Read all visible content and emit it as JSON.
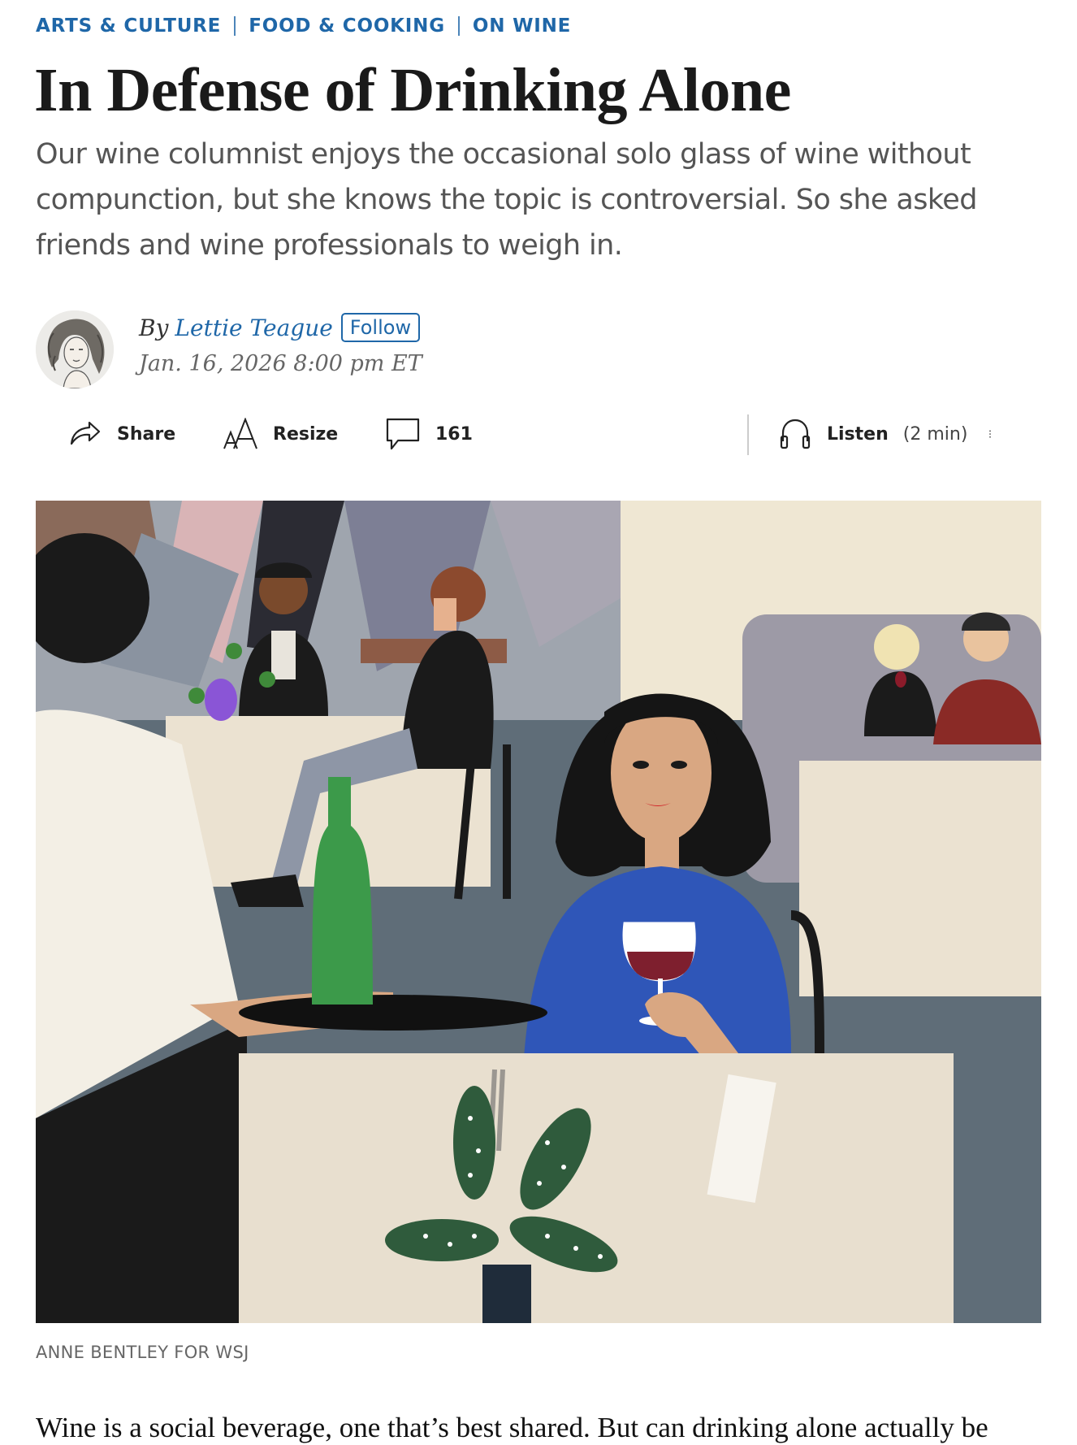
{
  "breadcrumb": {
    "items": [
      "ARTS & CULTURE",
      "FOOD & COOKING",
      "ON WINE"
    ]
  },
  "article": {
    "headline": "In Defense of Drinking Alone",
    "dek": "Our wine columnist enjoys the occasional solo glass of wine without compunction, but she knows the topic is controversial. So she asked friends and wine professionals to weigh in.",
    "byline_prefix": "By",
    "author": "Lettie Teague",
    "follow_label": "Follow",
    "timestamp": "Jan. 16, 2026 8:00 pm ET",
    "image_caption": "ANNE BENTLEY FOR WSJ",
    "first_paragraph": "Wine is a social beverage, one that’s best shared. But can drinking alone actually be"
  },
  "toolbar": {
    "share_label": "Share",
    "resize_label": "Resize",
    "comments_count": "161",
    "listen_label": "Listen",
    "listen_duration": "(2 min)",
    "icons": [
      "share-icon",
      "resize-icon",
      "comment-icon",
      "headphones-icon",
      "more-icon"
    ]
  },
  "colors": {
    "accent": "#1f67a8",
    "headline": "#1a1a1a",
    "dek": "#555555"
  }
}
